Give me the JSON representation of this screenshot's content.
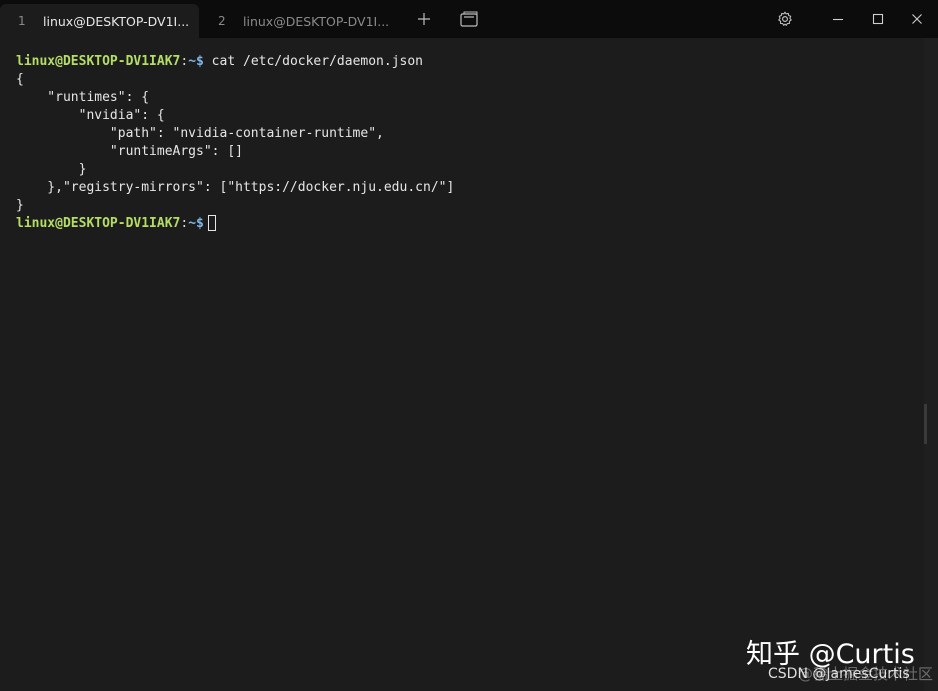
{
  "tabs": [
    {
      "number": "1",
      "title": "linux@DESKTOP-DV1I..."
    },
    {
      "number": "2",
      "title": "linux@DESKTOP-DV1I..."
    }
  ],
  "icons": {
    "new_tab": "plus-icon",
    "tab_switcher": "tab-switcher-icon",
    "settings": "gear-icon",
    "minimize": "minimize-icon",
    "maximize": "maximize-icon",
    "close": "close-icon"
  },
  "terminal": {
    "prompt_user": "linux@DESKTOP-DV1IAK7",
    "prompt_sep": ":",
    "prompt_path": "~$",
    "command": " cat /etc/docker/daemon.json",
    "output": [
      "{",
      "    \"runtimes\": {",
      "        \"nvidia\": {",
      "            \"path\": \"nvidia-container-runtime\",",
      "            \"runtimeArgs\": []",
      "        }",
      "    },\"registry-mirrors\": [\"https://docker.nju.edu.cn/\"]",
      "}"
    ]
  },
  "watermarks": {
    "zhihu": "知乎 @Curtis",
    "community": "@稀土掘金技术社区",
    "csdn": "CSDN @JamesCurtis"
  },
  "colors": {
    "prompt_user": "#b5dd63",
    "prompt_path": "#7fb6e8",
    "background": "#1c1c1c",
    "titlebar": "#0c0c0c"
  }
}
